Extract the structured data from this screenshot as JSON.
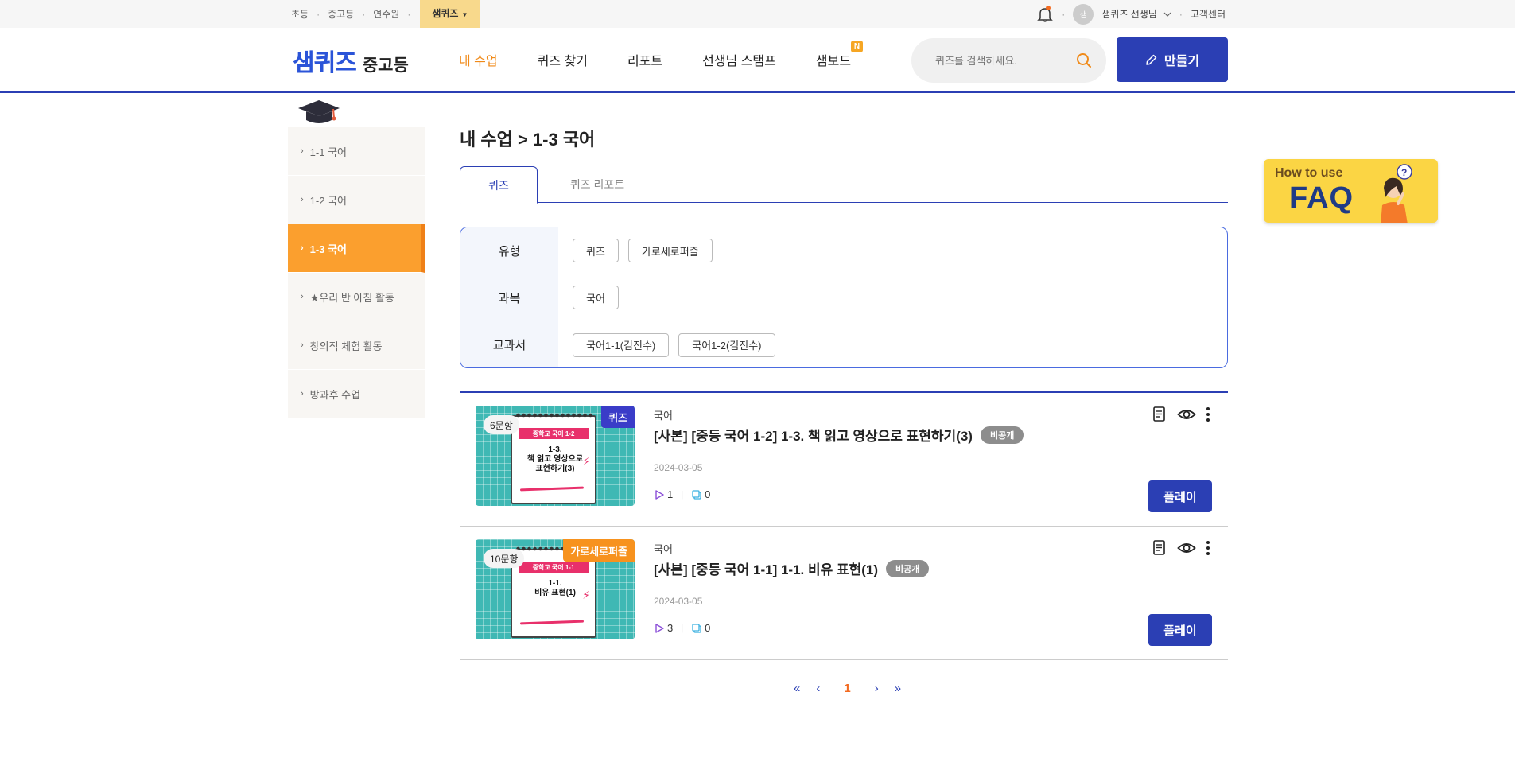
{
  "util_bar": {
    "links": [
      "초등",
      "중고등",
      "연수원"
    ],
    "active_link": "샘퀴즈",
    "user_name": "샘퀴즈 선생님",
    "avatar_text": "샘",
    "support": "고객센터"
  },
  "header": {
    "logo_main": "샘퀴즈",
    "logo_sub": "중고등",
    "nav": [
      {
        "label": "내 수업",
        "active": true
      },
      {
        "label": "퀴즈 찾기"
      },
      {
        "label": "리포트"
      },
      {
        "label": "선생님 스탬프"
      },
      {
        "label": "샘보드",
        "badge": "N"
      }
    ],
    "search_placeholder": "퀴즈를 검색하세요.",
    "make_button": "만들기"
  },
  "sidebar": {
    "items": [
      {
        "label": "1-1 국어"
      },
      {
        "label": "1-2 국어"
      },
      {
        "label": "1-3 국어",
        "active": true
      },
      {
        "label": "★우리 반 아침 활동"
      },
      {
        "label": "창의적 체험 활동"
      },
      {
        "label": "방과후 수업"
      }
    ]
  },
  "main": {
    "title": "내 수업 > 1-3 국어",
    "tabs": [
      "퀴즈",
      "퀴즈 리포트"
    ],
    "filters": [
      {
        "label": "유형",
        "chips": [
          "퀴즈",
          "가로세로퍼즐"
        ]
      },
      {
        "label": "과목",
        "chips": [
          "국어"
        ]
      },
      {
        "label": "교과서",
        "chips": [
          "국어1-1(김진수)",
          "국어1-2(김진수)"
        ]
      }
    ],
    "cards": [
      {
        "count": "6문항",
        "type": "퀴즈",
        "thumb_tag": "중학교 국어 1-2",
        "thumb_title_1": "1-3.",
        "thumb_title_2": "책 읽고 영상으로",
        "thumb_title_3": "표현하기(3)",
        "subject": "국어",
        "title": "[사본] [중등 국어 1-2] 1-3. 책 읽고 영상으로 표현하기(3)",
        "visibility": "비공개",
        "date": "2024-03-05",
        "plays": "1",
        "copies": "0",
        "play_button": "플레이"
      },
      {
        "count": "10문항",
        "type": "가로세로퍼즐",
        "thumb_tag": "중학교 국어 1-1",
        "thumb_title_1": "1-1.",
        "thumb_title_2": "비유 표현(1)",
        "thumb_title_3": "",
        "subject": "국어",
        "title": "[사본] [중등 국어 1-1] 1-1. 비유 표현(1)",
        "visibility": "비공개",
        "date": "2024-03-05",
        "plays": "3",
        "copies": "0",
        "play_button": "플레이"
      }
    ],
    "pagination": {
      "current": "1",
      "first": "«",
      "prev": "‹",
      "next": "›",
      "last": "»"
    }
  },
  "faq_banner": {
    "line1": "How to use",
    "line2": "FAQ"
  }
}
